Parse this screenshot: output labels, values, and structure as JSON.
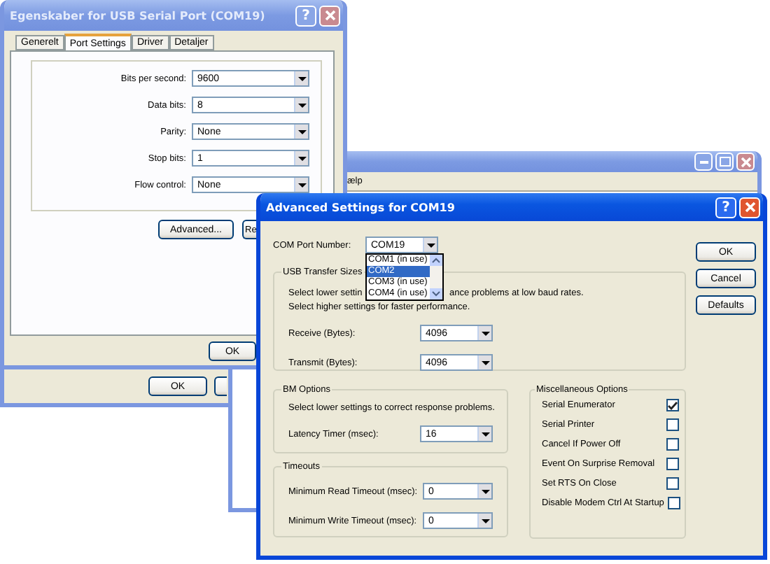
{
  "back_window": {
    "buttons": [
      "OK"
    ]
  },
  "middle_window": {
    "menu": "ælp"
  },
  "properties_window": {
    "title": "Egenskaber for USB Serial Port (COM19)",
    "help": "?",
    "tabs": [
      {
        "label": "Generelt",
        "selected": false
      },
      {
        "label": "Port Settings",
        "selected": true
      },
      {
        "label": "Driver",
        "selected": false
      },
      {
        "label": "Detaljer",
        "selected": false
      }
    ],
    "fields": [
      {
        "label": "Bits per second:",
        "value": "9600"
      },
      {
        "label": "Data bits:",
        "value": "8"
      },
      {
        "label": "Parity:",
        "value": "None"
      },
      {
        "label": "Stop bits:",
        "value": "1"
      },
      {
        "label": "Flow control:",
        "value": "None"
      }
    ],
    "buttons": [
      "Advanced...",
      "Re"
    ],
    "footer_button": "OK"
  },
  "advanced_window": {
    "title": "Advanced Settings for COM19",
    "help": "?",
    "com_port": {
      "label": "COM Port Number:",
      "value": "COM19",
      "options": [
        {
          "label": "COM1 (in use)",
          "selected": false
        },
        {
          "label": "COM2",
          "selected": true
        },
        {
          "label": "COM3 (in use)",
          "selected": false
        },
        {
          "label": "COM4 (in use)",
          "selected": false
        }
      ]
    },
    "buttons": [
      "OK",
      "Cancel",
      "Defaults"
    ],
    "usb_group": {
      "title": "USB Transfer Sizes",
      "notes": [
        [
          "Select lower settin",
          "ance problems at low baud rates."
        ],
        [
          "Select higher settings for faster performance."
        ]
      ],
      "fields": [
        {
          "label": "Receive (Bytes):",
          "value": "4096"
        },
        {
          "label": "Transmit (Bytes):",
          "value": "4096"
        }
      ]
    },
    "bm_group": {
      "title": "BM Options",
      "notes": [
        [
          "Select lower settings to correct response problems."
        ]
      ],
      "fields": [
        {
          "label": "Latency Timer (msec):",
          "value": "16"
        }
      ]
    },
    "timeouts_group": {
      "title": "Timeouts",
      "fields": [
        {
          "label": "Minimum Read Timeout (msec):",
          "value": "0"
        },
        {
          "label": "Minimum Write Timeout (msec):",
          "value": "0"
        }
      ]
    },
    "misc_group": {
      "title": "Miscellaneous Options",
      "options": [
        {
          "label": "Serial Enumerator",
          "checked": true
        },
        {
          "label": "Serial Printer",
          "checked": false
        },
        {
          "label": "Cancel If Power Off",
          "checked": false
        },
        {
          "label": "Event On Surprise Removal",
          "checked": false
        },
        {
          "label": "Set RTS On Close",
          "checked": false
        },
        {
          "label": "Disable Modem Ctrl At Startup",
          "checked": false
        }
      ]
    }
  }
}
